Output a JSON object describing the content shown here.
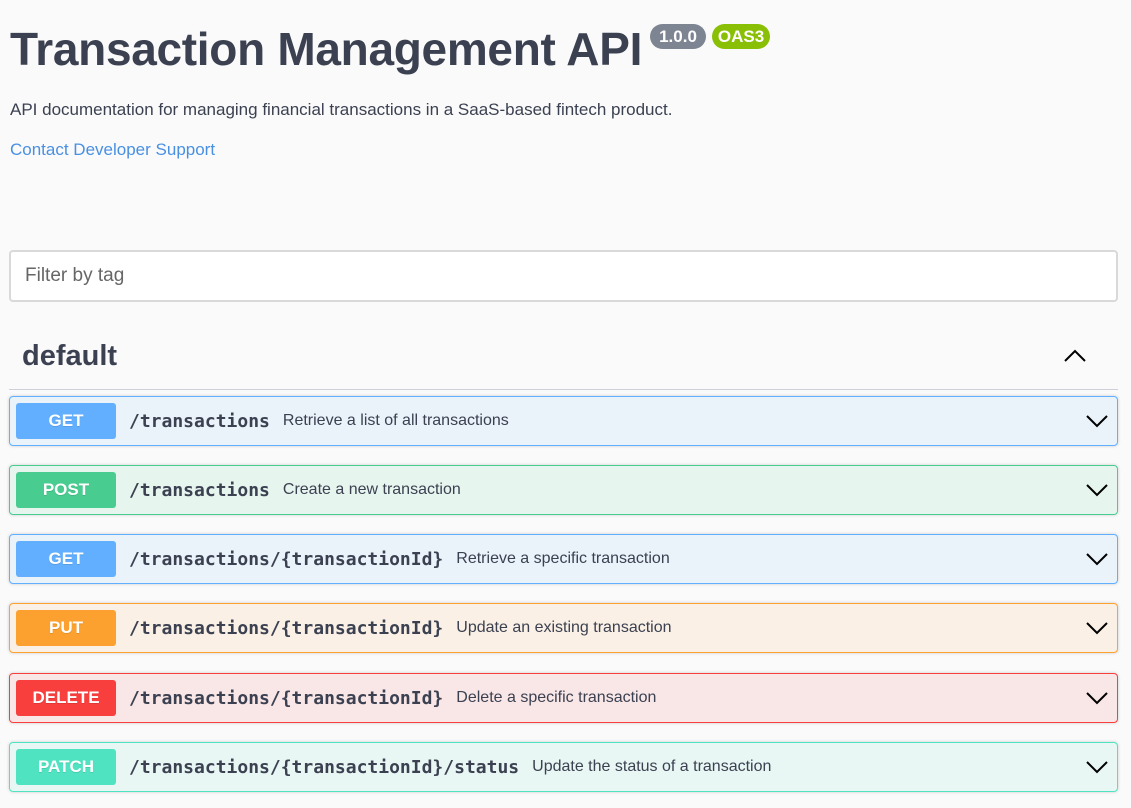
{
  "info": {
    "title": "Transaction Management API",
    "version": "1.0.0",
    "oas_badge": "OAS3",
    "description": "API documentation for managing financial transactions in a SaaS-based fintech product.",
    "contact_label": "Contact Developer Support"
  },
  "filter": {
    "placeholder": "Filter by tag",
    "value": ""
  },
  "tag": {
    "name": "default",
    "expanded": true,
    "chevron_icon": "chevron-up-icon"
  },
  "operations": [
    {
      "method": "GET",
      "path": "/transactions",
      "summary": "Retrieve a list of all transactions",
      "color": "#61affe"
    },
    {
      "method": "POST",
      "path": "/transactions",
      "summary": "Create a new transaction",
      "color": "#49cc90"
    },
    {
      "method": "GET",
      "path": "/transactions/{transactionId}",
      "summary": "Retrieve a specific transaction",
      "color": "#61affe"
    },
    {
      "method": "PUT",
      "path": "/transactions/{transactionId}",
      "summary": "Update an existing transaction",
      "color": "#fca130"
    },
    {
      "method": "DELETE",
      "path": "/transactions/{transactionId}",
      "summary": "Delete a specific transaction",
      "color": "#f93e3e"
    },
    {
      "method": "PATCH",
      "path": "/transactions/{transactionId}/status",
      "summary": "Update the status of a transaction",
      "color": "#50e3c2"
    }
  ],
  "colors": {
    "text": "#3b4151",
    "link": "#4990e2",
    "version_badge": "#7d8492",
    "oas_badge": "#89bf04"
  }
}
